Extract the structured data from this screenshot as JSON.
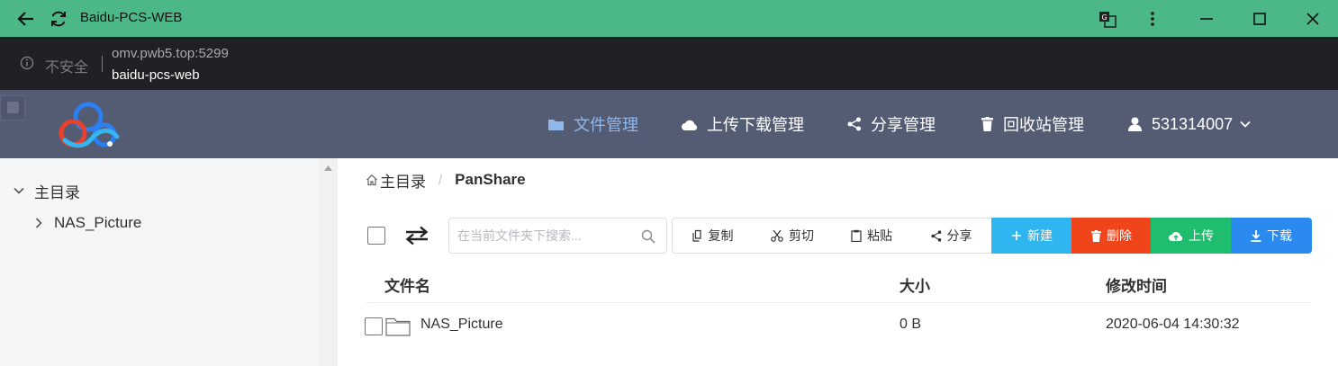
{
  "window": {
    "title": "Baidu-PCS-WEB",
    "colors": {
      "titlebar": "#4cb887",
      "addressbar": "#202124",
      "nav": "#545c74"
    }
  },
  "address": {
    "security_label": "不安全",
    "url": "omv.pwb5.top:5299",
    "page_title": "baidu-pcs-web"
  },
  "nav": {
    "items": [
      {
        "label": "文件管理",
        "icon": "folder-icon",
        "active": true
      },
      {
        "label": "上传下载管理",
        "icon": "cloud-icon",
        "active": false
      },
      {
        "label": "分享管理",
        "icon": "share-icon",
        "active": false
      },
      {
        "label": "回收站管理",
        "icon": "trash-icon",
        "active": false
      }
    ],
    "user": "531314007",
    "active_color": "#8fb8ec"
  },
  "sidebar": {
    "tree": [
      {
        "label": "主目录",
        "expanded": true
      },
      {
        "label": "NAS_Picture",
        "expanded": false
      }
    ]
  },
  "breadcrumb": {
    "home": "主目录",
    "separator": "/",
    "current": "PanShare"
  },
  "toolbar": {
    "search_placeholder": "在当前文件夹下搜索...",
    "copy": "复制",
    "cut": "剪切",
    "paste": "粘贴",
    "share": "分享",
    "new": "新建",
    "delete": "删除",
    "upload": "上传",
    "download": "下载",
    "colors": {
      "new": "#2fb5ef",
      "delete": "#f0441a",
      "upload": "#1fbd6e",
      "download": "#2b8af0"
    }
  },
  "table": {
    "columns": [
      "文件名",
      "大小",
      "修改时间"
    ],
    "rows": [
      {
        "name": "NAS_Picture",
        "size": "0 B",
        "modified": "2020-06-04 14:30:32",
        "type": "folder"
      }
    ]
  }
}
